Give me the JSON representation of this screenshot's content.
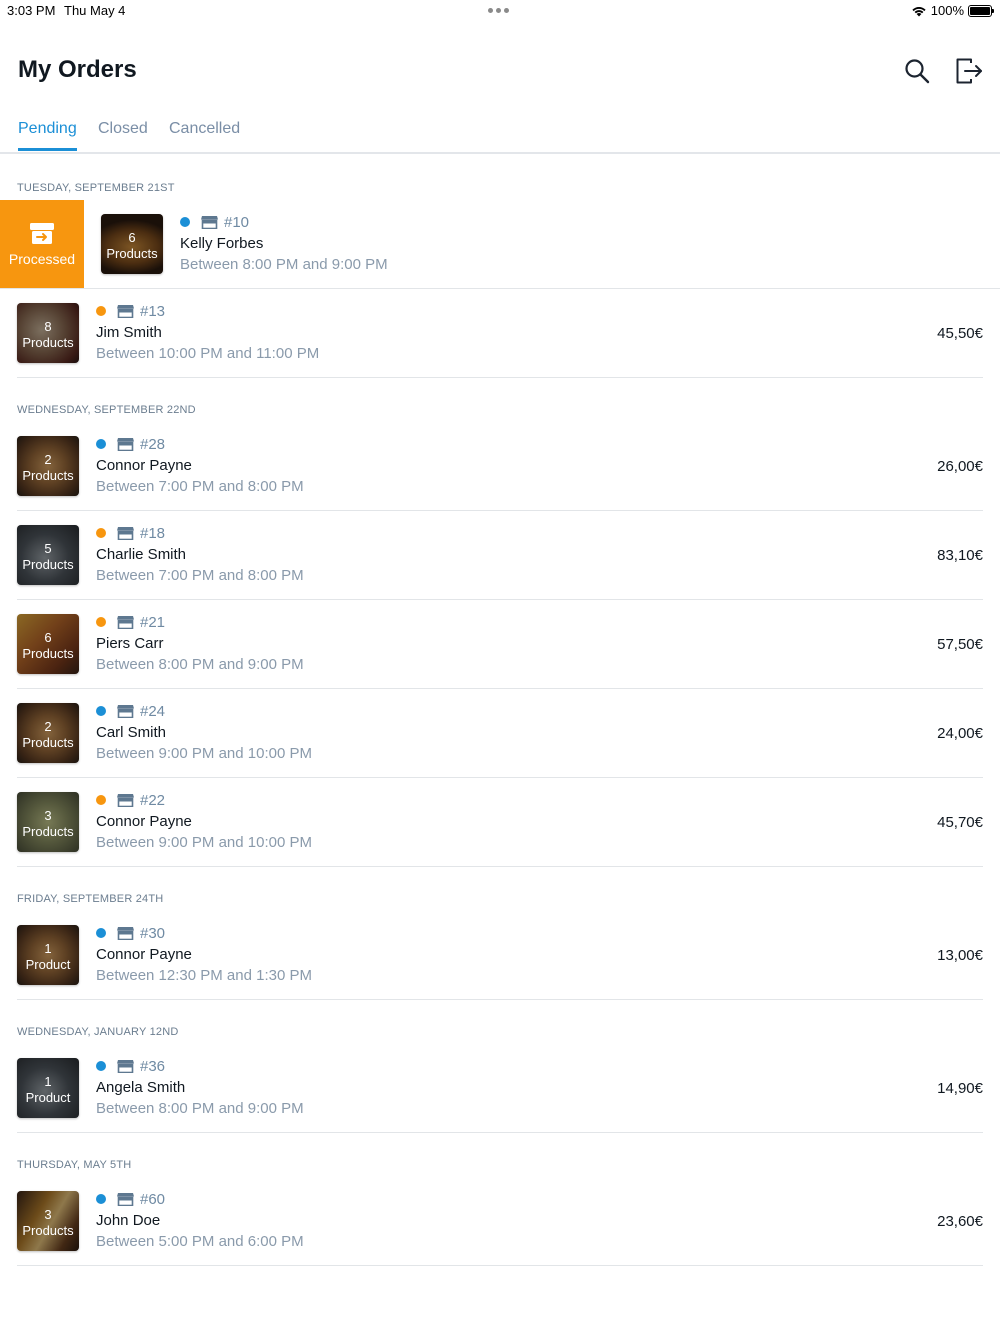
{
  "status_bar": {
    "time": "3:03 PM",
    "date": "Thu May 4",
    "battery": "100%"
  },
  "header": {
    "title": "My Orders",
    "search_icon": "search-icon",
    "logout_icon": "logout-icon"
  },
  "tabs": [
    {
      "label": "Pending",
      "active": true
    },
    {
      "label": "Closed",
      "active": false
    },
    {
      "label": "Cancelled",
      "active": false
    }
  ],
  "colors": {
    "accent": "#1b8fd6",
    "blue_dot": "#1b8fd6",
    "orange_dot": "#f7960f",
    "processed": "#f7960f"
  },
  "sections": [
    {
      "title": "TUESDAY, SEPTEMBER 21ST",
      "orders": [
        {
          "number": "#10",
          "customer": "Kelly Forbes",
          "window": "Between 8:00 PM and 9:00 PM",
          "price": "",
          "count": "6",
          "unit": "Products",
          "dot": "blue",
          "swiped": true,
          "action": "Processed",
          "thumb": "burger"
        },
        {
          "number": "#13",
          "customer": "Jim Smith",
          "window": "Between 10:00 PM and 11:00 PM",
          "price": "45,50€",
          "count": "8",
          "unit": "Products",
          "dot": "orange",
          "swiped": false,
          "thumb": "plate-red"
        }
      ]
    },
    {
      "title": "WEDNESDAY, SEPTEMBER 22ND",
      "orders": [
        {
          "number": "#28",
          "customer": "Connor Payne",
          "window": "Between 7:00 PM and 8:00 PM",
          "price": "26,00€",
          "count": "2",
          "unit": "Products",
          "dot": "blue",
          "swiped": false,
          "thumb": "pizza"
        },
        {
          "number": "#18",
          "customer": "Charlie Smith",
          "window": "Between 7:00 PM and 8:00 PM",
          "price": "83,10€",
          "count": "5",
          "unit": "Products",
          "dot": "orange",
          "swiped": false,
          "thumb": "pan"
        },
        {
          "number": "#21",
          "customer": "Piers Carr",
          "window": "Between 8:00 PM and 9:00 PM",
          "price": "57,50€",
          "count": "6",
          "unit": "Products",
          "dot": "orange",
          "swiped": false,
          "thumb": "fries"
        },
        {
          "number": "#24",
          "customer": "Carl Smith",
          "window": "Between 9:00 PM and 10:00 PM",
          "price": "24,00€",
          "count": "2",
          "unit": "Products",
          "dot": "blue",
          "swiped": false,
          "thumb": "pizza"
        },
        {
          "number": "#22",
          "customer": "Connor Payne",
          "window": "Between 9:00 PM and 10:00 PM",
          "price": "45,70€",
          "count": "3",
          "unit": "Products",
          "dot": "orange",
          "swiped": false,
          "thumb": "salad"
        }
      ]
    },
    {
      "title": "FRIDAY, SEPTEMBER 24TH",
      "orders": [
        {
          "number": "#30",
          "customer": "Connor Payne",
          "window": "Between 12:30 PM and 1:30 PM",
          "price": "13,00€",
          "count": "1",
          "unit": "Product",
          "dot": "blue",
          "swiped": false,
          "thumb": "pizza"
        }
      ]
    },
    {
      "title": "WEDNESDAY, JANUARY 12ND",
      "orders": [
        {
          "number": "#36",
          "customer": "Angela Smith",
          "window": "Between 8:00 PM and 9:00 PM",
          "price": "14,90€",
          "count": "1",
          "unit": "Product",
          "dot": "blue",
          "swiped": false,
          "thumb": "pan"
        }
      ]
    },
    {
      "title": "THURSDAY, MAY 5TH",
      "orders": [
        {
          "number": "#60",
          "customer": "John Doe",
          "window": "Between 5:00 PM and 6:00 PM",
          "price": "23,60€",
          "count": "3",
          "unit": "Products",
          "dot": "blue",
          "swiped": false,
          "thumb": "drinks"
        }
      ]
    }
  ]
}
